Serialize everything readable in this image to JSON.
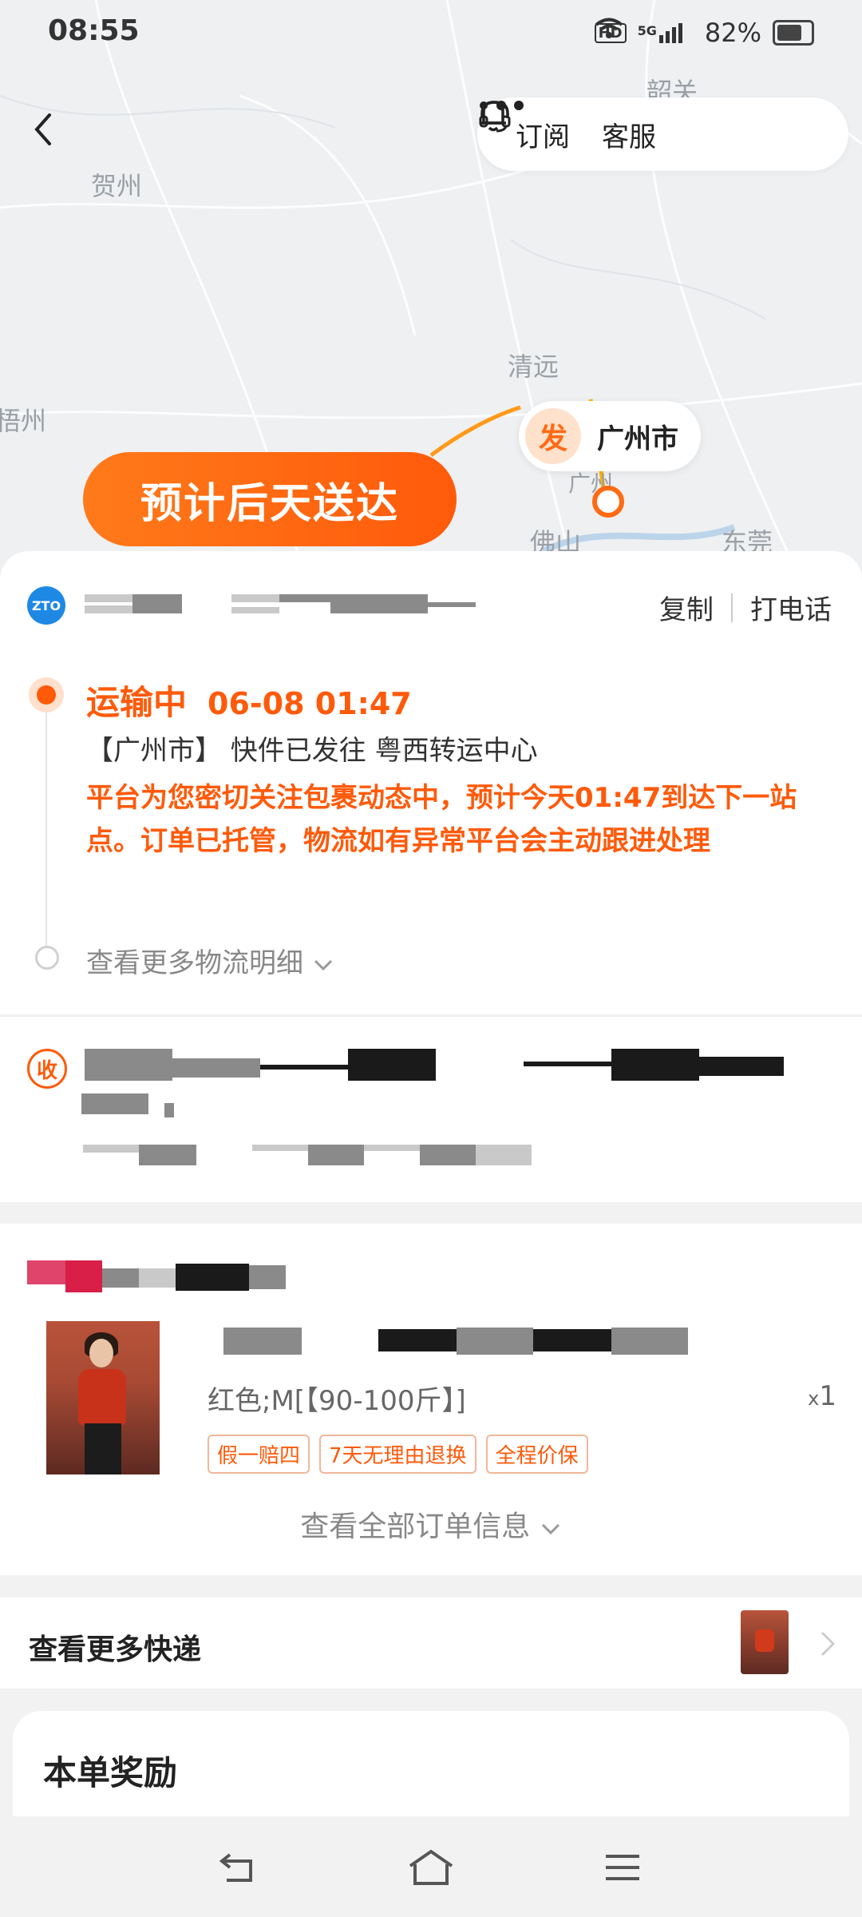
{
  "status_bar": {
    "time": "08:55",
    "network": "5G",
    "hd": "HD",
    "battery": "82%"
  },
  "map": {
    "cities": [
      "贺州",
      "韶关",
      "清远",
      "梧州",
      "佛山",
      "东莞",
      "广州"
    ],
    "eta_banner": "预计后天送达",
    "origin_badge": "发",
    "origin_city": "广州市"
  },
  "top_actions": {
    "subscribe": "订阅",
    "service": "客服"
  },
  "tracking": {
    "carrier_logo_text": "ZTO",
    "copy": "复制",
    "call": "打电话",
    "status": "运输中",
    "datetime": "06-08 01:47",
    "route": "【广州市】 快件已发往 粤西转运中心",
    "notice": "平台为您密切关注包裹动态中，预计今天01:47到达下一站点。订单已托管，物流如有异常平台会主动跟进处理",
    "more_details": "查看更多物流明细"
  },
  "receiver": {
    "badge": "收"
  },
  "order": {
    "variant": "红色;M[【90-100斤】]",
    "qty_x": "x",
    "qty": "1",
    "tags": [
      "假一赔四",
      "7天无理由退换",
      "全程价保"
    ],
    "view_all": "查看全部订单信息"
  },
  "more_express": {
    "title": "查看更多快递"
  },
  "reward": {
    "title": "本单奖励"
  },
  "colors": {
    "accent": "#ff5a0a",
    "eta_gradient_start": "#ff7a1a",
    "carrier_blue": "#1e88e5"
  }
}
